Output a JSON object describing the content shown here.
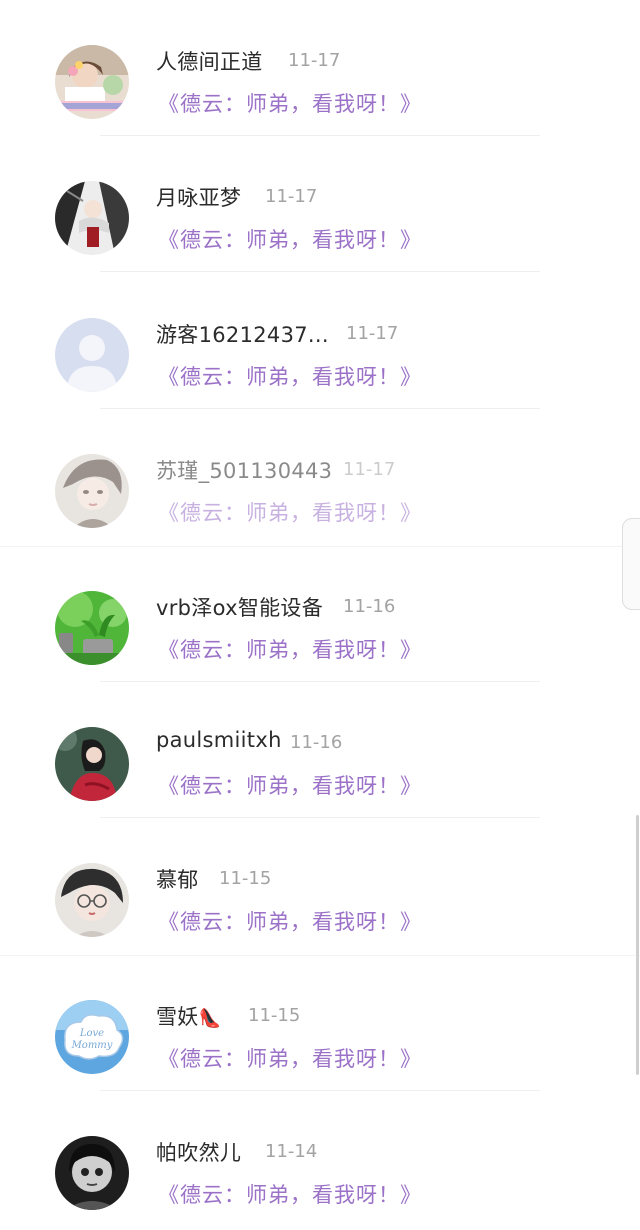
{
  "items": [
    {
      "name": "人德间正道",
      "date": "11-17",
      "book": "《德云：师弟，看我呀！》",
      "avatar_icon": "avatar-girl-flowers"
    },
    {
      "name": "月咏亚梦",
      "date": "11-17",
      "book": "《德云：师弟，看我呀！》",
      "avatar_icon": "avatar-anime-sketch"
    },
    {
      "name": "游客16212437...",
      "date": "11-17",
      "book": "《德云：师弟，看我呀！》",
      "avatar_icon": "avatar-default-user"
    },
    {
      "name": "苏瑾_501130443",
      "date": "11-17",
      "book": "《德云：师弟，看我呀！》",
      "avatar_icon": "avatar-anime-boy"
    },
    {
      "name": "vrb泽ox智能设备",
      "date": "11-16",
      "book": "《德云：师弟，看我呀！》",
      "avatar_icon": "avatar-green-plants"
    },
    {
      "name": "paulsmiitxh",
      "date": "11-16",
      "book": "《德云：师弟，看我呀！》",
      "avatar_icon": "avatar-woman-red"
    },
    {
      "name": "慕郁",
      "date": "11-15",
      "book": "《德云：师弟，看我呀！》",
      "avatar_icon": "avatar-glasses-girl"
    },
    {
      "name": "雪妖",
      "name_emoji": "👠",
      "date": "11-15",
      "book": "《德云：师弟，看我呀！》",
      "avatar_icon": "avatar-love-mommy"
    },
    {
      "name": "帕吹然儿",
      "date": "11-14",
      "book": "《德云：师弟，看我呀！》",
      "avatar_icon": "avatar-dark-portrait"
    }
  ],
  "avatar_text": {
    "love_mommy_line1": "Love",
    "love_mommy_line2": "Mommy"
  },
  "colors": {
    "book_title": "#9b72c8",
    "name": "#2b2b2b",
    "date": "#a3a3a3",
    "divider": "#efefef"
  }
}
